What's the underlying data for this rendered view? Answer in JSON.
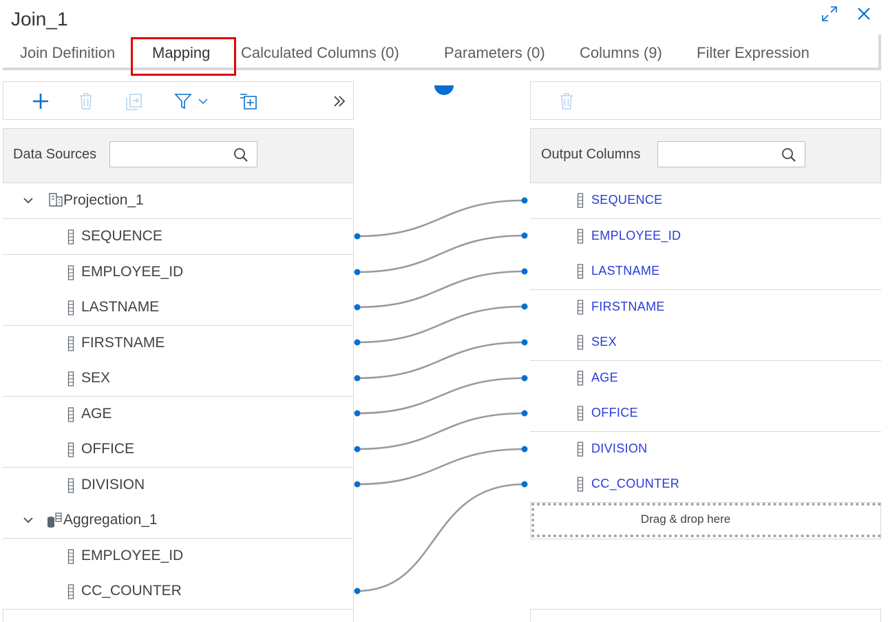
{
  "window": {
    "title": "Join_1"
  },
  "tabs": [
    {
      "label": "Join Definition",
      "active": false
    },
    {
      "label": "Mapping",
      "active": true
    },
    {
      "label": "Calculated Columns (0)",
      "active": false
    },
    {
      "label": "Parameters (0)",
      "active": false
    },
    {
      "label": "Columns (9)",
      "active": false
    },
    {
      "label": "Filter Expression",
      "active": false
    }
  ],
  "left": {
    "search_label": "Data Sources",
    "search_value": "",
    "nodes": [
      {
        "name": "Projection_1",
        "icon": "projection-icon",
        "columns": [
          "SEQUENCE",
          "EMPLOYEE_ID",
          "LASTNAME",
          "FIRSTNAME",
          "SEX",
          "AGE",
          "OFFICE",
          "DIVISION"
        ]
      },
      {
        "name": "Aggregation_1",
        "icon": "aggregation-icon",
        "columns": [
          "EMPLOYEE_ID",
          "CC_COUNTER"
        ]
      }
    ]
  },
  "right": {
    "search_label": "Output Columns",
    "search_value": "",
    "columns": [
      "SEQUENCE",
      "EMPLOYEE_ID",
      "LASTNAME",
      "FIRSTNAME",
      "SEX",
      "AGE",
      "OFFICE",
      "DIVISION",
      "CC_COUNTER"
    ],
    "dropzone_text": "Drag & drop here"
  },
  "mappings": [
    {
      "source": "Projection_1.SEQUENCE",
      "target": "SEQUENCE"
    },
    {
      "source": "Projection_1.EMPLOYEE_ID",
      "target": "EMPLOYEE_ID"
    },
    {
      "source": "Projection_1.LASTNAME",
      "target": "LASTNAME"
    },
    {
      "source": "Projection_1.FIRSTNAME",
      "target": "FIRSTNAME"
    },
    {
      "source": "Projection_1.SEX",
      "target": "SEX"
    },
    {
      "source": "Projection_1.AGE",
      "target": "AGE"
    },
    {
      "source": "Projection_1.OFFICE",
      "target": "OFFICE"
    },
    {
      "source": "Projection_1.DIVISION",
      "target": "DIVISION"
    },
    {
      "source": "Aggregation_1.CC_COUNTER",
      "target": "CC_COUNTER"
    }
  ],
  "icons": {
    "add": "plus-icon",
    "delete": "trash-icon",
    "import": "import-icon",
    "filter": "filter-icon",
    "insert": "add-to-list-icon",
    "collapse": "double-chevron-right-icon",
    "maximize": "maximize-icon",
    "close": "close-icon"
  },
  "colors": {
    "accent": "#0a6ed1",
    "output_text": "#2a3bd6",
    "highlight": "#e00000",
    "wire": "#9a9a9a"
  }
}
